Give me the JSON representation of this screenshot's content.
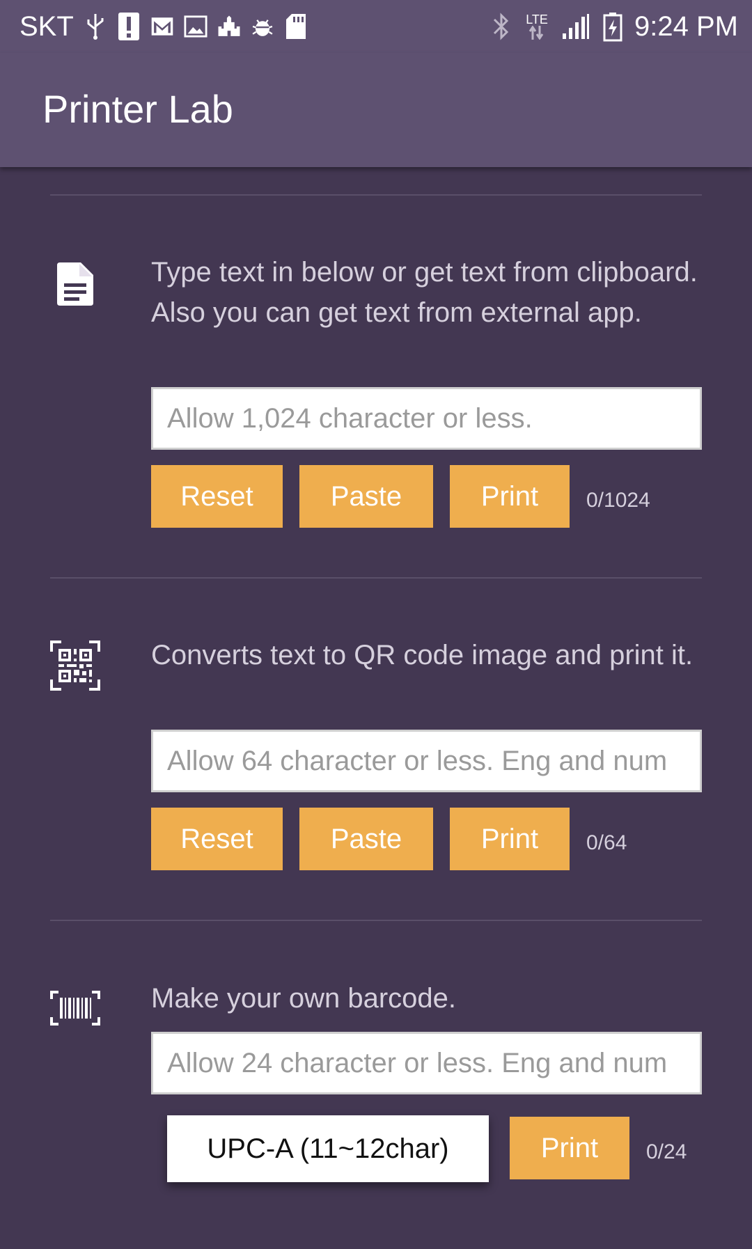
{
  "status_bar": {
    "carrier": "SKT",
    "lte_label": "LTE",
    "time": "9:24 PM",
    "left_icons": [
      "usb-icon",
      "alert-icon",
      "mail-icon",
      "image-icon",
      "castle-icon",
      "bug-icon",
      "sd-card-icon"
    ],
    "right_icons": [
      "bluetooth-icon",
      "lte-icon",
      "signal-icon",
      "battery-charging-icon"
    ]
  },
  "app_bar": {
    "title": "Printer Lab"
  },
  "sections": {
    "text": {
      "icon": "document-icon",
      "description": "Type text in below or get text from clipboard. Also you can get text from external app.",
      "placeholder": "Allow 1,024 character or less.",
      "reset_label": "Reset",
      "paste_label": "Paste",
      "print_label": "Print",
      "counter": "0/1024"
    },
    "qr": {
      "icon": "qr-code-icon",
      "description": "Converts text to QR code image and print it.",
      "placeholder": "Allow 64 character or less. Eng and num",
      "reset_label": "Reset",
      "paste_label": "Paste",
      "print_label": "Print",
      "counter": "0/64"
    },
    "barcode": {
      "icon": "barcode-icon",
      "description": "Make your own barcode.",
      "placeholder": "Allow 24 character or less. Eng and num",
      "barcode_type": "UPC-A (11~12char)",
      "print_label": "Print",
      "counter": "0/24"
    }
  },
  "colors": {
    "background": "#433752",
    "app_bar": "#5e5171",
    "button": "#efae4e",
    "text_light": "#d6d0dd"
  }
}
